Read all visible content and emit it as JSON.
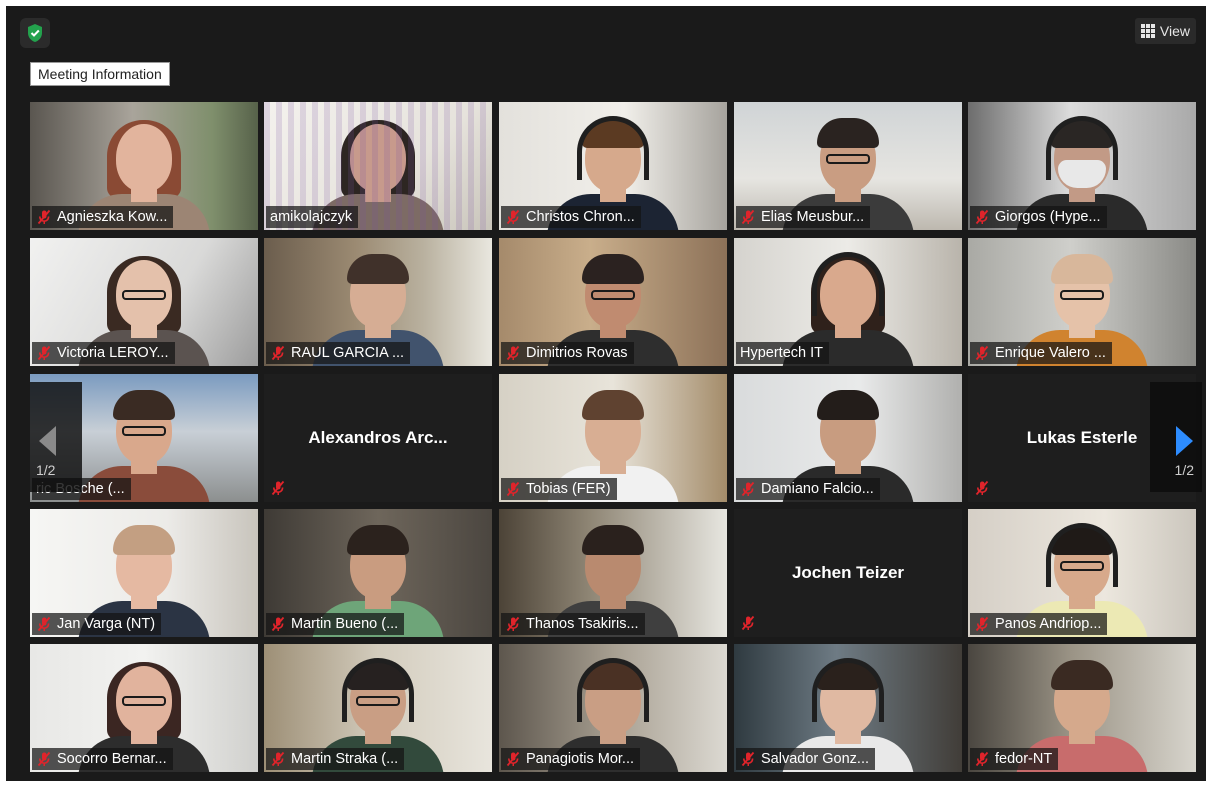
{
  "window": {
    "meeting_info_label": "Meeting Information",
    "view_label": "View"
  },
  "colors": {
    "background": "#1a1a1a",
    "active_speaker": "#d9e06b",
    "mute": "#e0242b",
    "shield": "#23a24d",
    "next_arrow": "#2d8cff"
  },
  "pagination": {
    "prev_count": "1/2",
    "next_count": "1/2"
  },
  "participants": [
    {
      "name": "Agnieszka Kow...",
      "muted": true,
      "video": true
    },
    {
      "name": "amikolajczyk",
      "muted": false,
      "video": true,
      "active": true
    },
    {
      "name": "Christos Chron...",
      "muted": true,
      "video": true
    },
    {
      "name": "Elias Meusbur...",
      "muted": true,
      "video": true
    },
    {
      "name": "Giorgos (Hype...",
      "muted": true,
      "video": true
    },
    {
      "name": "Victoria LEROY...",
      "muted": true,
      "video": true
    },
    {
      "name": "RAUL GARCIA ...",
      "muted": true,
      "video": true
    },
    {
      "name": "Dimitrios Rovas",
      "muted": true,
      "video": true
    },
    {
      "name": "Hypertech IT",
      "muted": false,
      "video": true
    },
    {
      "name": "Enrique Valero ...",
      "muted": true,
      "video": true
    },
    {
      "name": "ric Bosche (...",
      "muted": false,
      "video": true
    },
    {
      "name": "Alexandros Arc...",
      "muted": true,
      "video": false
    },
    {
      "name": "Tobias (FER)",
      "muted": true,
      "video": true
    },
    {
      "name": "Damiano Falcio...",
      "muted": true,
      "video": true
    },
    {
      "name": "Lukas Esterle",
      "muted": true,
      "video": false
    },
    {
      "name": "Jan Varga (NT)",
      "muted": true,
      "video": true
    },
    {
      "name": "Martin Bueno (...",
      "muted": true,
      "video": true
    },
    {
      "name": "Thanos Tsakiris...",
      "muted": true,
      "video": true
    },
    {
      "name": "Jochen Teizer",
      "muted": true,
      "video": false
    },
    {
      "name": "Panos Andriop...",
      "muted": true,
      "video": true
    },
    {
      "name": "Socorro Bernar...",
      "muted": true,
      "video": true
    },
    {
      "name": "Martin Straka (...",
      "muted": true,
      "video": true
    },
    {
      "name": "Panagiotis Mor...",
      "muted": true,
      "video": true
    },
    {
      "name": "Salvador Gonz...",
      "muted": true,
      "video": true
    },
    {
      "name": "fedor-NT",
      "muted": true,
      "video": true
    }
  ]
}
